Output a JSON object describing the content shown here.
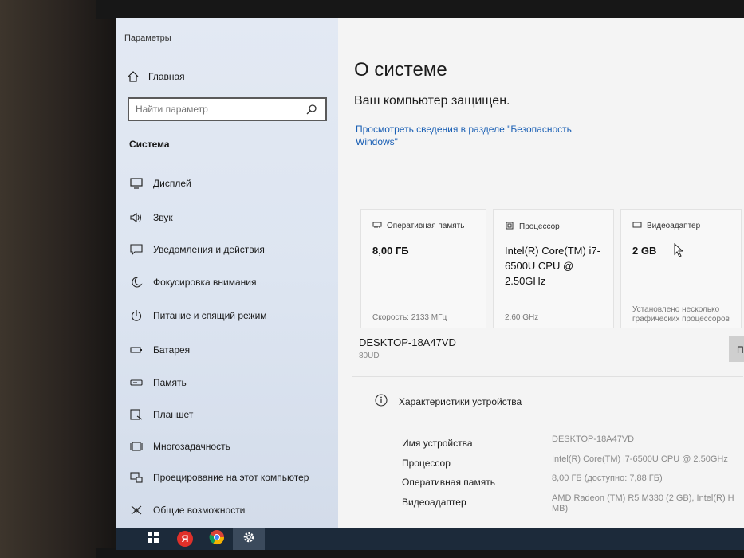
{
  "window": {
    "title": "Параметры"
  },
  "sidebar": {
    "home_label": "Главная",
    "search_placeholder": "Найти параметр",
    "section_title": "Система",
    "items": [
      {
        "label": "Дисплей",
        "icon": "monitor-icon"
      },
      {
        "label": "Звук",
        "icon": "speaker-icon"
      },
      {
        "label": "Уведомления и действия",
        "icon": "notification-icon"
      },
      {
        "label": "Фокусировка внимания",
        "icon": "moon-icon"
      },
      {
        "label": "Питание и спящий режим",
        "icon": "power-icon"
      },
      {
        "label": "Батарея",
        "icon": "battery-icon"
      },
      {
        "label": "Память",
        "icon": "storage-icon"
      },
      {
        "label": "Планшет",
        "icon": "tablet-icon"
      },
      {
        "label": "Многозадачность",
        "icon": "multitask-icon"
      },
      {
        "label": "Проецирование на этот компьютер",
        "icon": "project-icon"
      },
      {
        "label": "Общие возможности",
        "icon": "shared-icon"
      }
    ]
  },
  "main": {
    "title": "О системе",
    "protected": "Ваш компьютер защищен.",
    "security_link": "Просмотреть сведения в разделе \"Безопасность Windows\"",
    "cards": [
      {
        "title": "Оперативная память",
        "value": "8,00 ГБ",
        "footer": "Скорость: 2133 МГц",
        "icon": "memory-icon"
      },
      {
        "title": "Процессор",
        "value": "Intel(R) Core(TM) i7-6500U CPU @ 2.50GHz",
        "footer": "2.60 GHz",
        "icon": "cpu-icon"
      },
      {
        "title": "Видеоадаптер",
        "value": "2 GB",
        "footer": "Установлено несколько графических процессоров",
        "icon": "gpu-icon"
      }
    ],
    "device_name": "DESKTOP-18A47VD",
    "device_model": "80UD",
    "rename_button": "П",
    "specs_title": "Характеристики устройства",
    "specs": [
      {
        "label": "Имя устройства",
        "value": "DESKTOP-18A47VD"
      },
      {
        "label": "Процессор",
        "value": "Intel(R) Core(TM) i7-6500U CPU @ 2.50GHz"
      },
      {
        "label": "Оперативная память",
        "value": "8,00 ГБ (доступно: 7,88 ГБ)"
      },
      {
        "label": "Видеоадаптер",
        "value": "AMD Radeon (TM) R5 M330 (2 GB), Intel(R) H MB)"
      }
    ]
  },
  "taskbar": {
    "items": [
      {
        "icon": "windows-start-icon"
      },
      {
        "icon": "yandex-browser-icon",
        "text": "Я"
      },
      {
        "icon": "chrome-icon"
      },
      {
        "icon": "settings-gear-icon"
      }
    ]
  },
  "colors": {
    "accent": "#1a5fb4",
    "taskbar": "#1c2a3a",
    "sidebar": "#dde5f1"
  }
}
